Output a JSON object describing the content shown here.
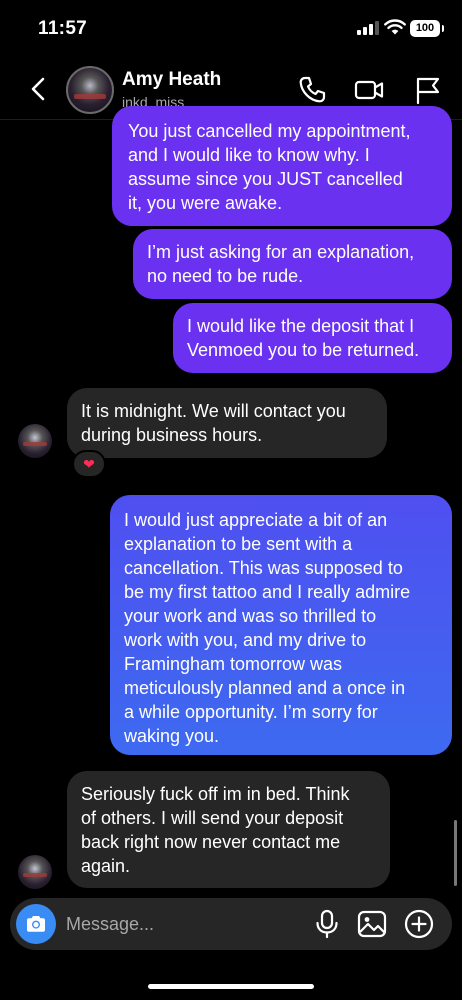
{
  "status_bar": {
    "time": "11:57",
    "battery": "100"
  },
  "header": {
    "contact_name": "Amy Heath",
    "contact_handle": "inkd_miss",
    "icons": [
      "back-arrow-icon",
      "phone-icon",
      "video-camera-icon",
      "flag-icon"
    ]
  },
  "messages": [
    {
      "sender": "me",
      "text": "You just cancelled my appointment,\nand I would like to know why. I\nassume since you JUST cancelled\nit, you were awake."
    },
    {
      "sender": "me",
      "text": "I’m just asking for an explanation,\nno need to be rude."
    },
    {
      "sender": "me",
      "text": "I would like the deposit that I\nVenmoed you to be returned."
    },
    {
      "sender": "them",
      "text": "It is midnight. We will contact you\nduring business hours.",
      "reaction": "❤"
    },
    {
      "sender": "me",
      "text": "I would just appreciate a bit of an\nexplanation to be sent with a\ncancellation. This was supposed to\nbe my first tattoo and I really admire\nyour work and was so thrilled to\nwork with you, and my drive to\nFramingham tomorrow was\nmeticulously planned and a once in\na while opportunity. I’m sorry for\nwaking you."
    },
    {
      "sender": "them",
      "text": "Seriously fuck off im in bed. Think\nof others. I will send your deposit\nback right now never contact me\nagain."
    }
  ],
  "composer": {
    "placeholder": "Message...",
    "icons": [
      "camera-icon",
      "microphone-icon",
      "image-icon",
      "plus-circle-icon"
    ]
  },
  "colors": {
    "background": "#000000",
    "outgoing_purple": "#6a32f0",
    "outgoing_blue": "#3d6af0",
    "incoming": "#262626",
    "camera_button": "#3a8cf5",
    "heart": "#ff2d55"
  }
}
